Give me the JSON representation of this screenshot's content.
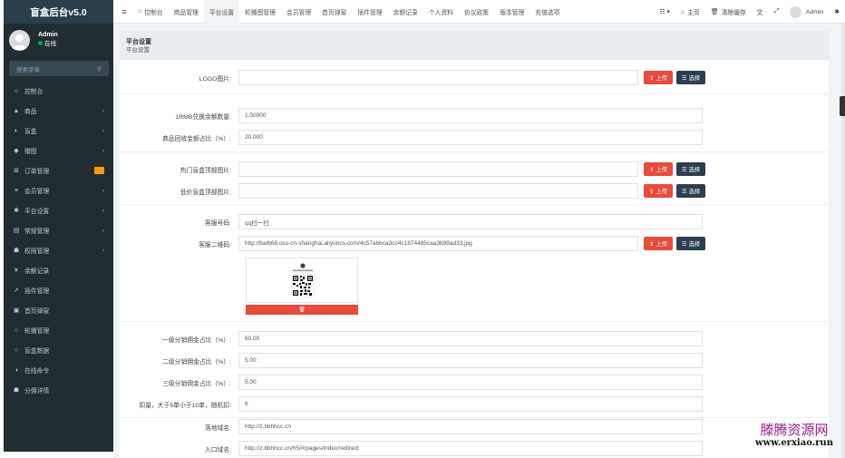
{
  "brand": "盲盒后台v5.0",
  "user": {
    "name": "Admin",
    "status": "在线"
  },
  "search": {
    "placeholder": "搜索菜单",
    "icon": "search-icon"
  },
  "sidebar": {
    "items": [
      {
        "label": "控制台",
        "icon": "dashboard-icon",
        "glyph": "⌂"
      },
      {
        "label": "商品",
        "icon": "shop-icon",
        "glyph": "▲",
        "chev": "‹"
      },
      {
        "label": "盲盒",
        "icon": "gift-box-icon",
        "glyph": "◐",
        "chev": "‹"
      },
      {
        "label": "赠图",
        "icon": "tag-icon",
        "glyph": "◆",
        "chev": "‹"
      },
      {
        "label": "订单管理",
        "icon": "cart-icon",
        "glyph": "⊞",
        "badge": true
      },
      {
        "label": "会员管理",
        "icon": "list-icon",
        "glyph": "≡",
        "chev": "‹"
      },
      {
        "label": "平台设置",
        "icon": "gear-icon",
        "glyph": "✱",
        "chev": "‹"
      },
      {
        "label": "常规管理",
        "icon": "document-icon",
        "glyph": "▤",
        "chev": "‹"
      },
      {
        "label": "权限管理",
        "icon": "group-icon",
        "glyph": "☗",
        "chev": "‹"
      },
      {
        "label": "余额记录",
        "icon": "yen-icon",
        "glyph": "¥"
      },
      {
        "label": "插件管理",
        "icon": "rocket-icon",
        "glyph": "➚"
      },
      {
        "label": "首页弹窗",
        "icon": "image-icon",
        "glyph": "▣"
      },
      {
        "label": "轮播管理",
        "icon": "circle-icon",
        "glyph": "○"
      },
      {
        "label": "盲盒数据",
        "icon": "circle-icon",
        "glyph": "○"
      },
      {
        "label": "在线命令",
        "icon": "half-circle-icon",
        "glyph": "◑"
      },
      {
        "label": "分佣详情",
        "icon": "group-icon",
        "glyph": "☗"
      }
    ]
  },
  "navbar": {
    "toggle_icon": "menu-toggle-icon",
    "tabs": [
      {
        "label": "控制台",
        "glyph": "⌂",
        "icon": "dashboard-icon"
      },
      {
        "label": "商品管理"
      },
      {
        "label": "平台设置",
        "active": true
      },
      {
        "label": "轮播图管理"
      },
      {
        "label": "会员管理"
      },
      {
        "label": "首页弹窗"
      },
      {
        "label": "插件管理"
      },
      {
        "label": "余额记录"
      },
      {
        "label": "个人资料"
      },
      {
        "label": "协议政策"
      },
      {
        "label": "版本管理"
      },
      {
        "label": "充值选项"
      }
    ],
    "right": {
      "grid_icon": "☷ ▾",
      "home": "主页",
      "clear_cache": "清除缓存",
      "user": "Admin"
    }
  },
  "page": {
    "title": "平台设置",
    "subtitle": "平台设置"
  },
  "buttons": {
    "upload": "上传",
    "choose": "选择",
    "delete_icon": "trash-icon"
  },
  "form": {
    "logo_label": "LOGO图片:",
    "logo_value": "",
    "rmb_label": "1RMB兑换余额数量:",
    "rmb_value": "1.00000",
    "recycle_label": "商品回收金额占比（%）:",
    "recycle_value": "20.000",
    "hot_label": "热门盲盒顶部图片:",
    "hot_value": "",
    "low_label": "低价盲盒顶部图片:",
    "low_value": "",
    "service_label": "客服号码:",
    "service_value": "qq扫一扫",
    "qrcode_label": "客服二维码:",
    "qrcode_value": "http://bat668.oss-cn-shanghai.aliyuncs.com/4c57abbca3cc4c1874485caa3b99ad33.jpg",
    "lvl1_label": "一级分销佣金占比（%）:",
    "lvl1_value": "60.00",
    "lvl2_label": "二级分销佣金占比（%）:",
    "lvl2_value": "5.00",
    "lvl3_label": "三级分销佣金占比（%）:",
    "lvl3_value": "5.00",
    "deduct_label": "扣量，大于5单小于10单，随机扣:",
    "deduct_value": "6",
    "domain_label": "落地域名:",
    "domain_value": "http://z.bbhhcc.cn",
    "entry_label": "入口域名:",
    "entry_value": "http://z.bbhhcc.cn/h5/#/pages/index/redirect"
  },
  "qr_preview": {
    "caption": "添加好友二维码"
  },
  "watermark": {
    "line1": "滕腾资源网",
    "line2": "www.erxiao.run"
  }
}
